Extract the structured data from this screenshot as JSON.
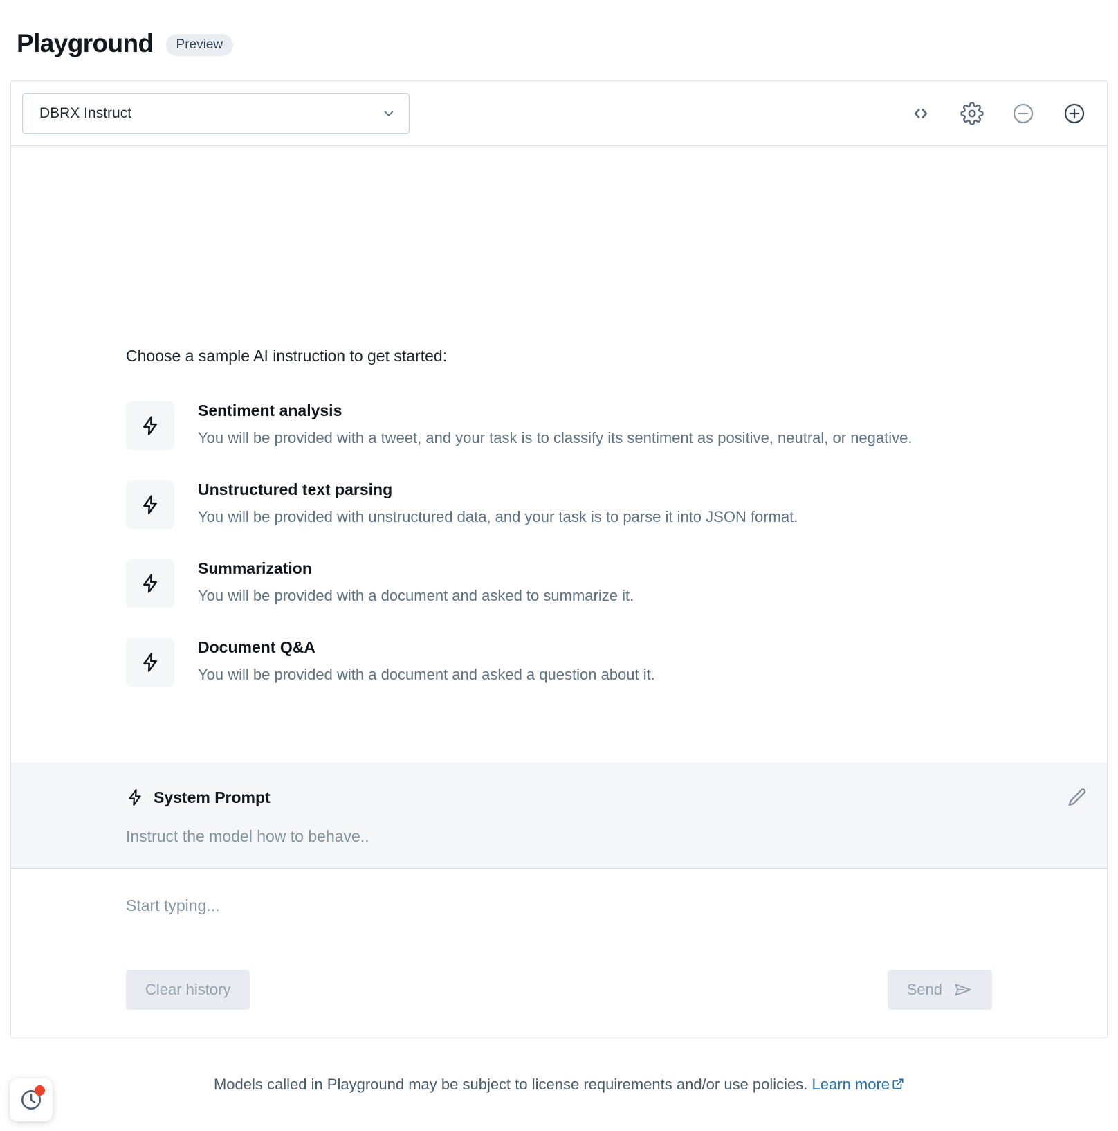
{
  "header": {
    "title": "Playground",
    "badge": "Preview"
  },
  "toolbar": {
    "model_selected": "DBRX Instruct",
    "icons": [
      {
        "name": "code-icon",
        "label": "< >"
      },
      {
        "name": "gear-icon",
        "label": "Settings"
      },
      {
        "name": "minus-circle-icon",
        "label": "Remove model"
      },
      {
        "name": "plus-circle-icon",
        "label": "Add model"
      }
    ]
  },
  "samples": {
    "heading": "Choose a sample AI instruction to get started:",
    "items": [
      {
        "title": "Sentiment analysis",
        "description": "You will be provided with a tweet, and your task is to classify its sentiment as positive, neutral, or negative."
      },
      {
        "title": "Unstructured text parsing",
        "description": "You will be provided with unstructured data, and your task is to parse it into JSON format."
      },
      {
        "title": "Summarization",
        "description": "You will be provided with a document and asked to summarize it."
      },
      {
        "title": "Document Q&A",
        "description": "You will be provided with a document and asked a question about it."
      }
    ]
  },
  "system_prompt": {
    "title": "System Prompt",
    "placeholder": "Instruct the model how to behave..",
    "value": ""
  },
  "composer": {
    "placeholder": "Start typing...",
    "value": "",
    "clear_label": "Clear history",
    "send_label": "Send"
  },
  "footer": {
    "text": "Models called in Playground may be subject to license requirements and/or use policies.",
    "link_label": "Learn more"
  },
  "history_widget": {
    "icon": "clock-icon",
    "has_notification": true
  },
  "colors": {
    "accent_link": "#2272b4",
    "badge_bg": "#e8edf2",
    "panel_bg": "#f5f6f8",
    "border": "#dce0e5",
    "muted_text": "#5f7281",
    "notification": "#e8432f"
  }
}
